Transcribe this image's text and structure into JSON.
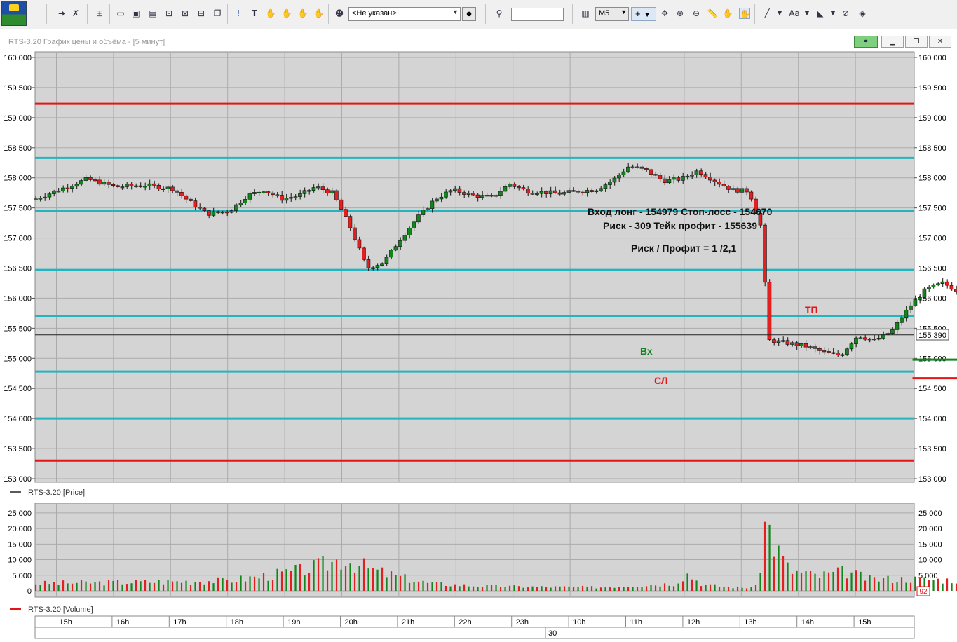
{
  "toolbar": {
    "user_select_value": "<Не указан>",
    "search_value": "",
    "timeframe_value": "M5",
    "icons": [
      "arrow-icon",
      "delete-drawing-icon",
      "new-chart-icon",
      "window-icon",
      "window-icon",
      "bar-chart-icon",
      "zoom-window-icon",
      "zoom-window-icon",
      "cancel-zoom-icon",
      "copy-icon",
      "alert-icon",
      "text-tool-icon",
      "hand-icon",
      "hand-icon",
      "hand-icon",
      "user-icon",
      "user-search-icon",
      "search-icon",
      "crosshair-icon",
      "move-icon",
      "zoom-in-icon",
      "zoom-out-icon",
      "ruler-icon",
      "pan-hand-icon",
      "select-hand-icon",
      "line-tool-icon",
      "font-icon",
      "fill-icon",
      "visibility-icon",
      "layers-icon"
    ]
  },
  "window": {
    "title": "RTS-3.20 График цены и объёма - [5 минут]"
  },
  "price_panel": {
    "legend_label": "RTS-3.20 [Price]",
    "last_price_label": "155 390"
  },
  "volume_panel": {
    "legend_label": "RTS-3.20 [Volume]",
    "last_volume_label": "92"
  },
  "annotations": {
    "line1": "Вход лонг  - 154979   Стоп-лосс  - 154670",
    "line2": "Риск - 309      Тейк профит - 155639",
    "line3": "Риск / Профит = 1 /2,1",
    "entry_label": "Вх",
    "stop_label": "СЛ",
    "take_label": "ТП"
  },
  "colors": {
    "up_candle": "#12851d",
    "down_candle": "#e41f1f",
    "cyan_level": "#23b4bf",
    "red_level": "#e31515",
    "grid": "#ababab",
    "plot_bg": "#d4d4d4"
  },
  "chart_data": [
    {
      "type": "candlestick",
      "title": "",
      "ylim": [
        153000,
        160000
      ],
      "y_ticks": [
        "160 000",
        "159 500",
        "159 000",
        "158 500",
        "158 000",
        "157 500",
        "157 000",
        "156 500",
        "156 000",
        "155 500",
        "155 000",
        "154 500",
        "154 000",
        "153 500",
        "153 000"
      ],
      "x_ticks": [
        "15h",
        "16h",
        "17h",
        "18h",
        "19h",
        "20h",
        "21h",
        "22h",
        "23h",
        "10h",
        "11h",
        "12h",
        "13h",
        "14h",
        "15h"
      ],
      "date_label": "30",
      "last_price": 155390,
      "levels": [
        {
          "price": 159230,
          "color": "red"
        },
        {
          "price": 158330,
          "color": "cyan"
        },
        {
          "price": 157450,
          "color": "cyan"
        },
        {
          "price": 156470,
          "color": "cyan"
        },
        {
          "price": 155700,
          "color": "cyan"
        },
        {
          "price": 154780,
          "color": "cyan"
        },
        {
          "price": 154000,
          "color": "cyan"
        },
        {
          "price": 153300,
          "color": "red"
        }
      ],
      "trade_lines": [
        {
          "role": "entry",
          "price": 154979
        },
        {
          "role": "stop",
          "price": 154670
        },
        {
          "role": "take",
          "price": 155639
        }
      ],
      "close_path": [
        157650,
        157800,
        157980,
        157850,
        157880,
        157820,
        157600,
        157400,
        157450,
        157700,
        157800,
        157650,
        157700,
        157850,
        157750,
        157200,
        156500,
        156600,
        157000,
        157350,
        157650,
        157800,
        157700,
        157680,
        157900,
        157780,
        157760,
        157740,
        157780,
        157800,
        157950,
        158200,
        158120,
        157950,
        157980,
        158120,
        157950,
        157800,
        157780,
        157200,
        155300,
        155250,
        155200,
        155100,
        155050,
        155380,
        155300,
        155450,
        155850,
        156150,
        156250,
        156100,
        156050,
        156220,
        155800,
        155900,
        156200,
        155800,
        155650,
        155500,
        155300,
        155390
      ],
      "close_path_x_hours": [
        14.6,
        15,
        15.5,
        16,
        16.5,
        17,
        17.3,
        17.6,
        18,
        18.3,
        18.6,
        18.9,
        19.2,
        19.5,
        19.8,
        20.1,
        20.4,
        20.7,
        21,
        21.3,
        21.6,
        21.9,
        22.3,
        22.6,
        22.9,
        23.2,
        23.5,
        23.8,
        24.1,
        24.4,
        24.7,
        25,
        25.3,
        25.6,
        25.9,
        26.2,
        26.5,
        26.8,
        27.1,
        27.3,
        27.45,
        27.8,
        28.1,
        28.4,
        28.7,
        29,
        29.3,
        29.6,
        29.9,
        30.2,
        30.5,
        30.8,
        31.1,
        31.4,
        31.7,
        32,
        32.3,
        32.6,
        32.9,
        33.2,
        33.5,
        33.75
      ]
    },
    {
      "type": "bar",
      "title": "",
      "ylim": [
        0,
        27000
      ],
      "y_ticks": [
        "25 000",
        "20 000",
        "15 000",
        "10 000",
        "5 000",
        "0"
      ],
      "profile": [
        [
          14.6,
          2500
        ],
        [
          16.5,
          3000
        ],
        [
          18,
          3500
        ],
        [
          19,
          6000
        ],
        [
          19.5,
          8000
        ],
        [
          20,
          11000
        ],
        [
          20.5,
          7000
        ],
        [
          21,
          4500
        ],
        [
          21.5,
          2500
        ],
        [
          22.5,
          1500
        ],
        [
          24.5,
          1200
        ],
        [
          25.8,
          2500
        ],
        [
          26,
          6000
        ],
        [
          26.3,
          2000
        ],
        [
          27,
          1000
        ],
        [
          27.25,
          1500
        ],
        [
          27.4,
          26000
        ],
        [
          27.5,
          17000
        ],
        [
          27.8,
          7000
        ],
        [
          28.3,
          5000
        ],
        [
          28.8,
          6500
        ],
        [
          29.2,
          4000
        ],
        [
          30,
          4000
        ],
        [
          31,
          3500
        ],
        [
          32,
          3000
        ],
        [
          33,
          2500
        ],
        [
          33.75,
          2000
        ]
      ]
    }
  ]
}
